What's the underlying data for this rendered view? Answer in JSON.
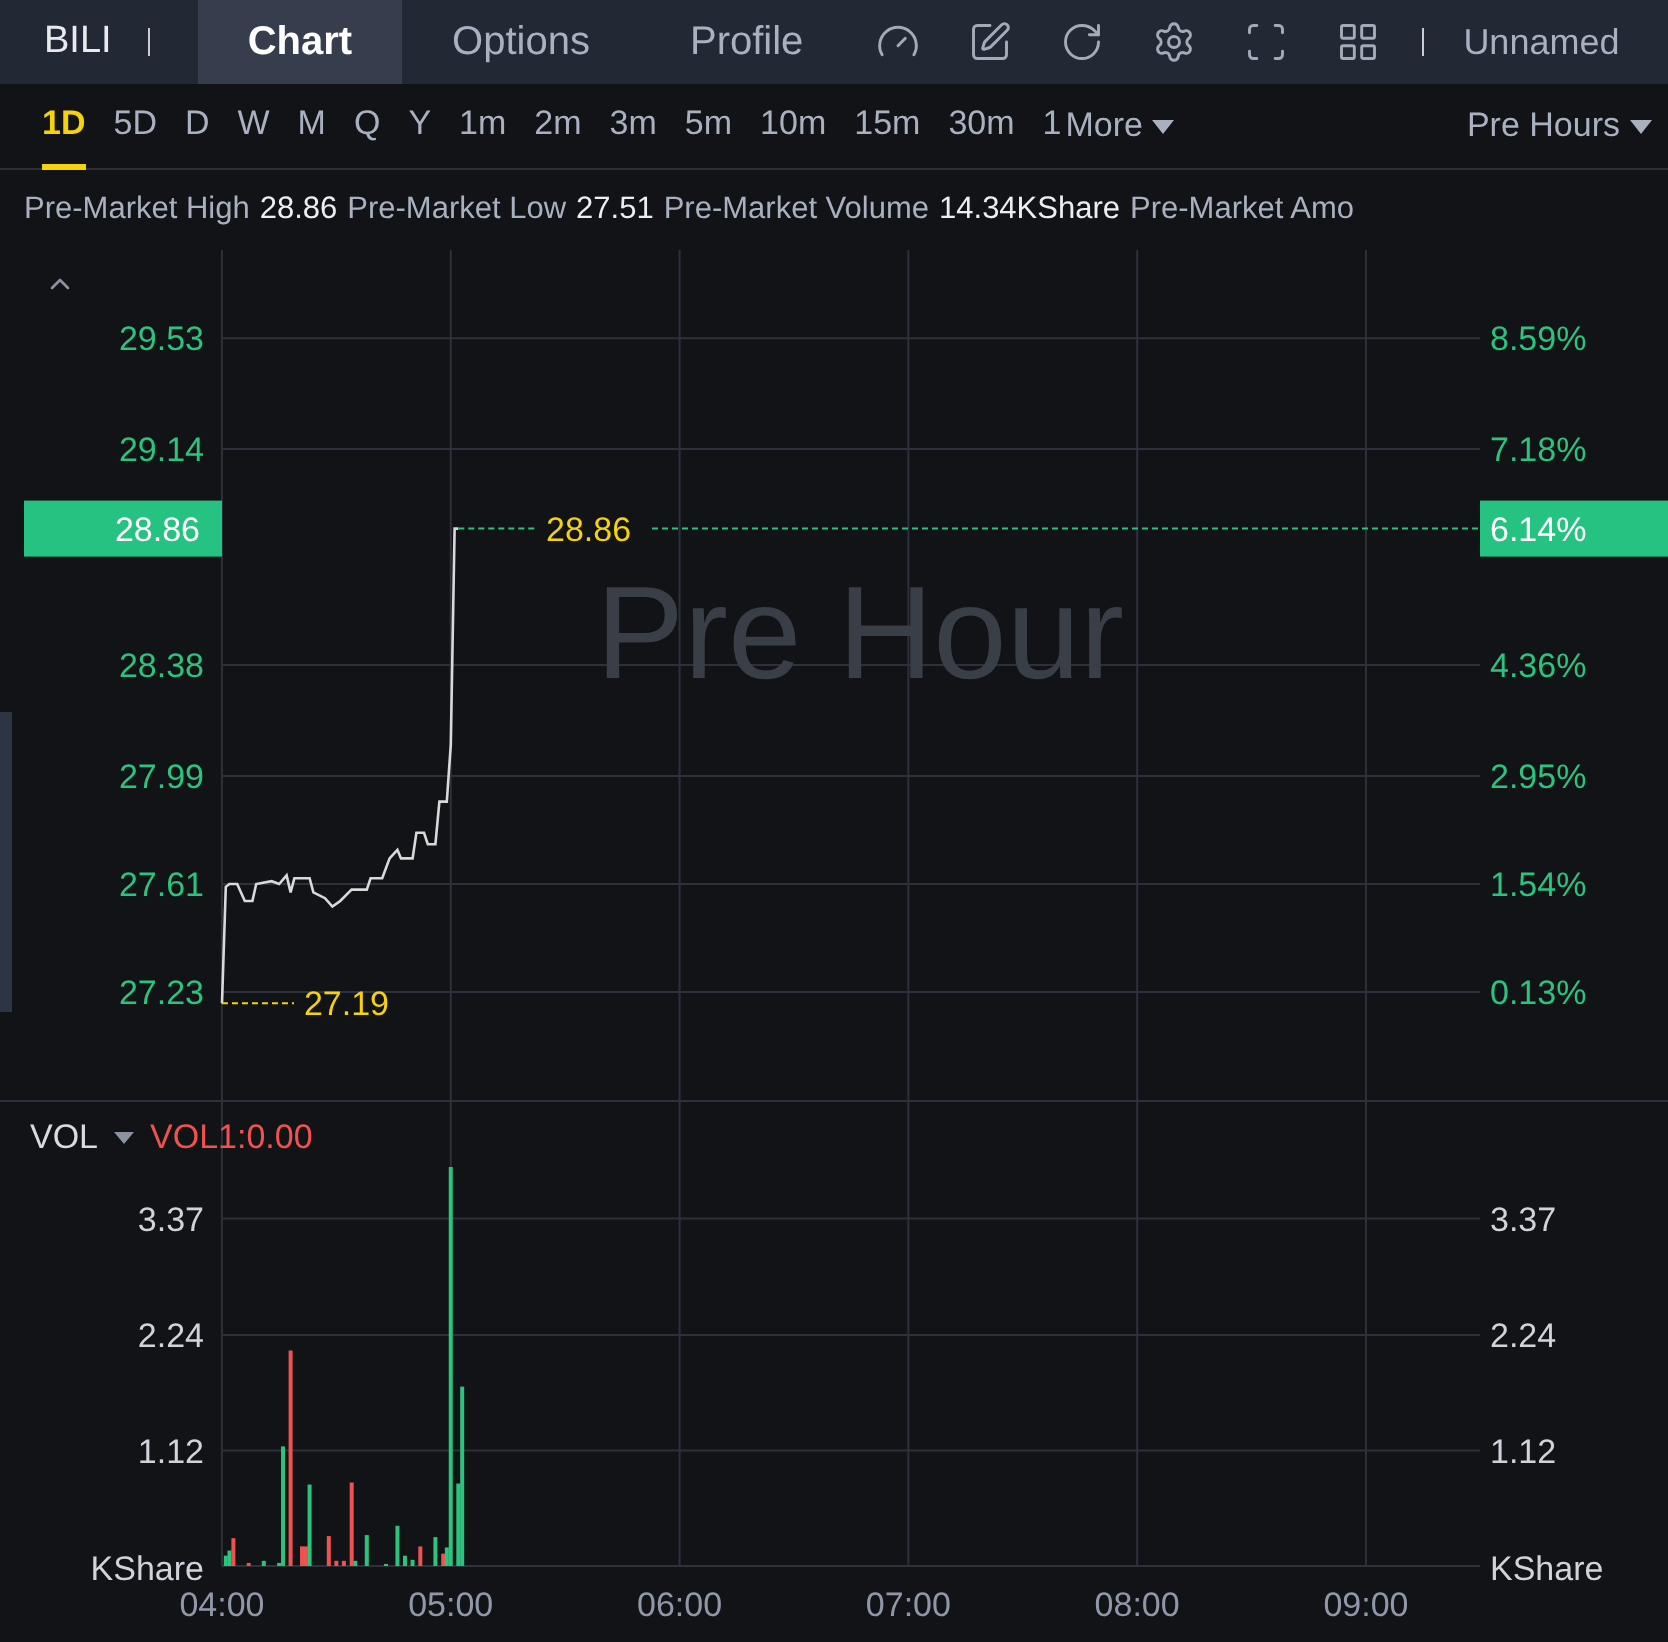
{
  "header": {
    "symbol": "BILI",
    "tabs": [
      {
        "label": "Chart",
        "selected": true
      },
      {
        "label": "Options",
        "selected": false
      },
      {
        "label": "Profile",
        "selected": false
      }
    ],
    "layout_name": "Unnamed"
  },
  "periods": [
    {
      "label": "1D",
      "selected": true
    },
    {
      "label": "5D",
      "selected": false
    },
    {
      "label": "D",
      "selected": false
    },
    {
      "label": "W",
      "selected": false
    },
    {
      "label": "M",
      "selected": false
    },
    {
      "label": "Q",
      "selected": false
    },
    {
      "label": "Y",
      "selected": false
    },
    {
      "label": "1m",
      "selected": false
    },
    {
      "label": "2m",
      "selected": false
    },
    {
      "label": "3m",
      "selected": false
    },
    {
      "label": "5m",
      "selected": false
    },
    {
      "label": "10m",
      "selected": false
    },
    {
      "label": "15m",
      "selected": false
    },
    {
      "label": "30m",
      "selected": false
    },
    {
      "label": "1",
      "selected": false
    }
  ],
  "more_menu": {
    "label": "More"
  },
  "session_menu": {
    "label": "Pre Hours"
  },
  "stats": [
    {
      "label": "Pre-Market High",
      "value": "28.86"
    },
    {
      "label": "Pre-Market Low",
      "value": "27.51"
    },
    {
      "label": "Pre-Market Volume",
      "value": "14.34KShare"
    },
    {
      "label": "Pre-Market Amo"
    }
  ],
  "price_chart": {
    "watermark": "Pre Hour",
    "right_axis_labels": [
      "8.59%",
      "7.18%",
      "4.36%",
      "2.95%",
      "1.54%",
      "0.13%"
    ],
    "price_badge": {
      "price": "28.86",
      "change": "6.14%"
    },
    "last_price_label": "28.86",
    "low_label": "27.19",
    "chart_data": {
      "type": "line",
      "grid": true,
      "xlim": [
        3.03,
        10.32
      ],
      "ylim": [
        26.85,
        29.84
      ],
      "yticks": [
        {
          "value": 29.53,
          "label": "29.53"
        },
        {
          "value": 29.14,
          "label": "29.14"
        },
        {
          "value": 28.38,
          "label": "28.38"
        },
        {
          "value": 27.99,
          "label": "27.99"
        },
        {
          "value": 27.61,
          "label": "27.61"
        },
        {
          "value": 27.23,
          "label": "27.23"
        }
      ],
      "x": [
        4,
        4.017,
        4.033,
        4.067,
        4.1,
        4.133,
        4.15,
        4.217,
        4.25,
        4.283,
        4.3,
        4.317,
        4.383,
        4.4,
        4.45,
        4.483,
        4.517,
        4.567,
        4.633,
        4.65,
        4.7,
        4.733,
        4.767,
        4.783,
        4.833,
        4.85,
        4.883,
        4.9,
        4.933,
        4.95,
        4.983,
        5,
        5.017,
        5.033
      ],
      "series": [
        {
          "color": "#d9d9d9",
          "values": [
            27.19,
            27.6,
            27.61,
            27.61,
            27.55,
            27.55,
            27.61,
            27.62,
            27.61,
            27.64,
            27.58,
            27.63,
            27.63,
            27.58,
            27.56,
            27.53,
            27.55,
            27.59,
            27.59,
            27.63,
            27.63,
            27.7,
            27.73,
            27.7,
            27.7,
            27.79,
            27.79,
            27.75,
            27.75,
            27.9,
            27.9,
            28.1,
            28.86,
            28.86
          ]
        }
      ]
    }
  },
  "volume_chart": {
    "indicator": "VOL",
    "reading": "VOL1:0.00",
    "right_axis_labels": [
      "3.37",
      "2.24",
      "1.12"
    ],
    "left_unit": "KShare",
    "right_unit": "KShare",
    "chart_data": {
      "type": "bar",
      "grid": true,
      "stacked": true,
      "xlim": [
        3.03,
        10.32
      ],
      "ylim": [
        0,
        4.52
      ],
      "yticks": [
        {
          "value": 3.37,
          "label": "3.37"
        },
        {
          "value": 2.24,
          "label": "2.24"
        },
        {
          "value": 1.12,
          "label": "1.12"
        }
      ],
      "xticks": [
        {
          "value": 4,
          "label": "04:00"
        },
        {
          "value": 5,
          "label": "05:00"
        },
        {
          "value": 6,
          "label": "06:00"
        },
        {
          "value": 7,
          "label": "07:00"
        },
        {
          "value": 8,
          "label": "08:00"
        },
        {
          "value": 9,
          "label": "09:00"
        }
      ],
      "x": [
        4.017,
        4.033,
        4.05,
        4.117,
        4.183,
        4.25,
        4.267,
        4.3,
        4.35,
        4.367,
        4.383,
        4.467,
        4.5,
        4.533,
        4.567,
        4.583,
        4.633,
        4.717,
        4.767,
        4.8,
        4.833,
        4.867,
        4.933,
        4.967,
        4.983,
        5,
        5.033,
        5.05
      ],
      "series": [
        {
          "color": "#2bc47d",
          "values": [
            0.1,
            0.15,
            null,
            null,
            0.05,
            0.03,
            1.16,
            null,
            null,
            null,
            0.79,
            null,
            null,
            null,
            null,
            0.05,
            0.3,
            0.02,
            0.39,
            0.1,
            0.06,
            null,
            0.28,
            null,
            0.18,
            3.87,
            0.8,
            1.74
          ]
        },
        {
          "color": "#f0524f",
          "values": [
            null,
            null,
            0.27,
            0.03,
            null,
            null,
            null,
            2.09,
            0.19,
            0.19,
            null,
            0.29,
            0.05,
            0.05,
            0.81,
            null,
            null,
            null,
            null,
            null,
            null,
            0.19,
            null,
            0.12,
            null,
            null,
            null,
            null
          ]
        }
      ]
    }
  }
}
